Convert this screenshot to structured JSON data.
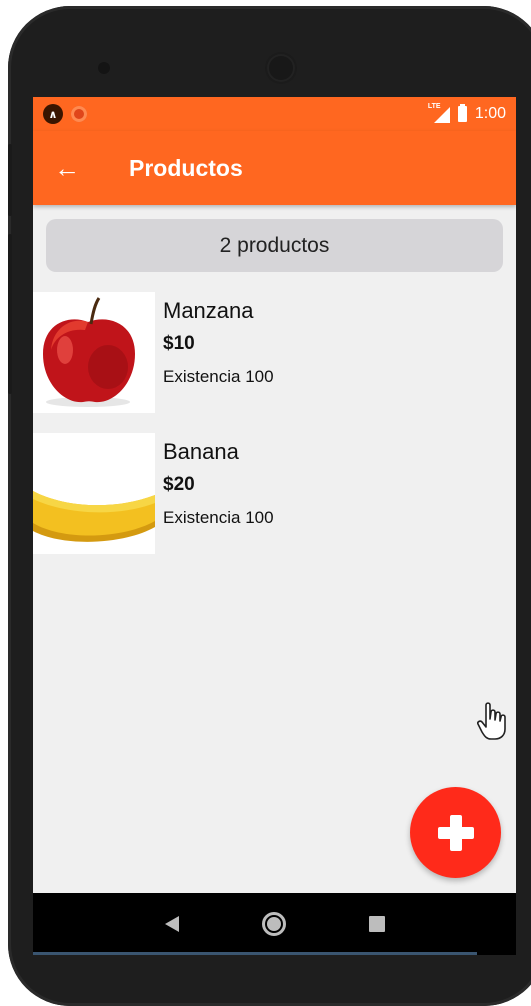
{
  "status_bar": {
    "time": "1:00",
    "network_label": "LTE",
    "icons": [
      "expo-icon",
      "notification-dot-icon",
      "lte-signal-icon",
      "battery-icon"
    ]
  },
  "app_bar": {
    "title": "Productos",
    "back_icon": "arrow-left-icon",
    "back_glyph": "←"
  },
  "summary": {
    "count_text": "2 productos"
  },
  "products": [
    {
      "name": "Manzana",
      "price": "$10",
      "stock": "Existencia 100",
      "image": "red-apple"
    },
    {
      "name": "Banana",
      "price": "$20",
      "stock": "Existencia 100",
      "image": "yellow-banana"
    }
  ],
  "fab": {
    "icon": "plus-icon"
  },
  "nav_bar": {
    "icons": [
      "nav-back-icon",
      "nav-home-icon",
      "nav-recent-apps-icon"
    ]
  },
  "colors": {
    "primary": "#ff6720",
    "fab": "#ff2a1a",
    "background": "#f0f0f0",
    "pill": "#d6d5d8"
  }
}
